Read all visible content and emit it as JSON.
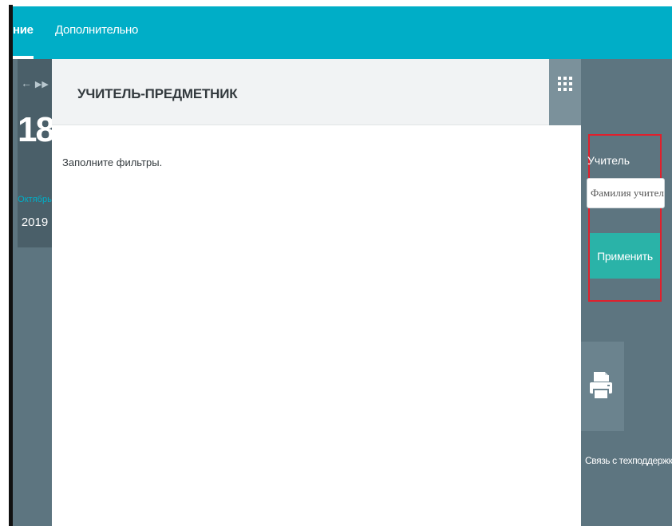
{
  "topbar": {
    "tabs": [
      {
        "label": "ние",
        "active": true
      },
      {
        "label": "Дополнительно",
        "active": false
      }
    ]
  },
  "date": {
    "day": "18",
    "month": "Октябрь",
    "year": "2019",
    "nav_icons": [
      "arrow-left-icon",
      "fast-forward-icon"
    ]
  },
  "main": {
    "title": "УЧИТЕЛЬ-ПРЕДМЕТНИК",
    "hint": "Заполните фильтры.",
    "grid_icon": "grid-icon"
  },
  "filter": {
    "label": "Учитель",
    "input_placeholder": "Фамилия учителя",
    "input_value": "",
    "apply_label": "Применить"
  },
  "sidebar": {
    "print_icon": "printer-icon",
    "support_label": "Связь с техподдержкой"
  },
  "colors": {
    "topbar": "#00aec7",
    "panel": "#5d7580",
    "apply_button": "#2ab3a8",
    "highlight": "#e0202c"
  }
}
